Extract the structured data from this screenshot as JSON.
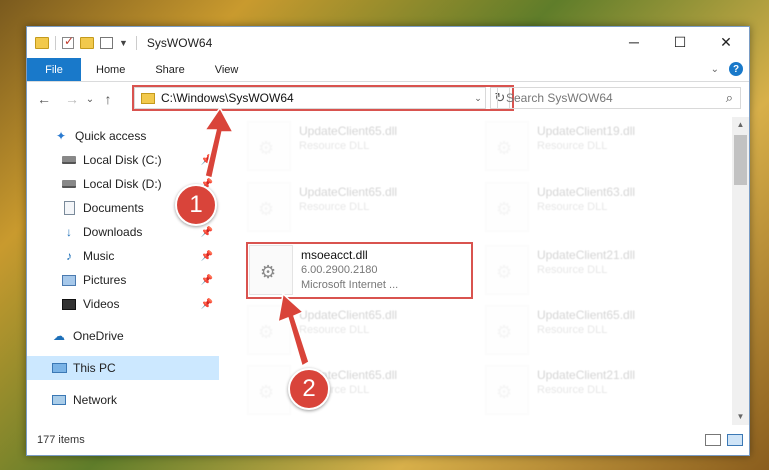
{
  "window": {
    "title": "SysWOW64"
  },
  "controls": {
    "minimize": "─",
    "maximize": "☐",
    "close": "✕"
  },
  "ribbon": {
    "file": "File",
    "tabs": [
      "Home",
      "Share",
      "View"
    ],
    "help": "?"
  },
  "nav": {
    "back": "←",
    "forward": "→",
    "recent": "⌄",
    "up": "↑",
    "path": "C:\\Windows\\SysWOW64",
    "refresh": "↻",
    "search_placeholder": "Search SysWOW64"
  },
  "sidebar": {
    "items": [
      {
        "label": "Quick access",
        "icon": "star-icon"
      },
      {
        "label": "Local Disk (C:)",
        "icon": "disk-icon"
      },
      {
        "label": "Local Disk (D:)",
        "icon": "disk-icon"
      },
      {
        "label": "Documents",
        "icon": "documents-icon"
      },
      {
        "label": "Downloads",
        "icon": "downloads-icon"
      },
      {
        "label": "Music",
        "icon": "music-icon"
      },
      {
        "label": "Pictures",
        "icon": "pictures-icon"
      },
      {
        "label": "Videos",
        "icon": "videos-icon"
      },
      {
        "label": "OneDrive",
        "icon": "onedrive-icon"
      },
      {
        "label": "This PC",
        "icon": "this-pc-icon"
      },
      {
        "label": "Network",
        "icon": "network-icon"
      }
    ]
  },
  "files": [
    {
      "name": "UpdateClient65.dll",
      "sub": "Resource DLL"
    },
    {
      "name": "UpdateClient19.dll",
      "sub": "Resource DLL"
    },
    {
      "name": "UpdateClient65.dll",
      "sub": "Resource DLL"
    },
    {
      "name": "UpdateClient63.dll",
      "sub": "Resource DLL"
    },
    {
      "name": "msoeacct.dll",
      "version": "6.00.2900.2180",
      "company": "Microsoft Internet ..."
    },
    {
      "name": "UpdateClient21.dll",
      "sub": "Resource DLL"
    },
    {
      "name": "UpdateClient65.dll",
      "sub": "Resource DLL"
    },
    {
      "name": "UpdateClient65.dll",
      "sub": "Resource DLL"
    },
    {
      "name": "UpdateClient65.dll",
      "sub": "Resource DLL"
    },
    {
      "name": "UpdateClient21.dll",
      "sub": "Resource DLL"
    }
  ],
  "status": {
    "count": "177 items"
  },
  "annotations": {
    "step1": "1",
    "step2": "2"
  }
}
